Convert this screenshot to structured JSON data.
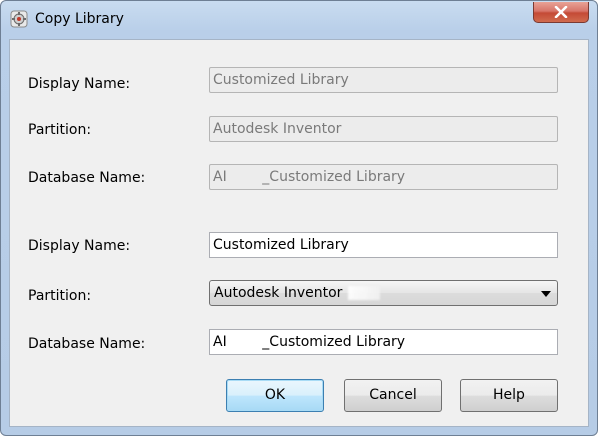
{
  "window": {
    "title": "Copy Library",
    "icons": {
      "app": "app-gear-icon",
      "close": "close-icon"
    }
  },
  "source": {
    "display_name_label": "Display Name:",
    "display_name_value": "Customized Library",
    "partition_label": "Partition:",
    "partition_value": "Autodesk Inventor",
    "database_name_label": "Database Name:",
    "database_name_value": "AI        _Customized Library"
  },
  "target": {
    "display_name_label": "Display Name:",
    "display_name_value": "Customized Library",
    "partition_label": "Partition:",
    "partition_selected": "Autodesk Inventor",
    "database_name_label": "Database Name:",
    "database_name_value": "AI        _Customized Library"
  },
  "buttons": {
    "ok": "OK",
    "cancel": "Cancel",
    "help": "Help"
  }
}
